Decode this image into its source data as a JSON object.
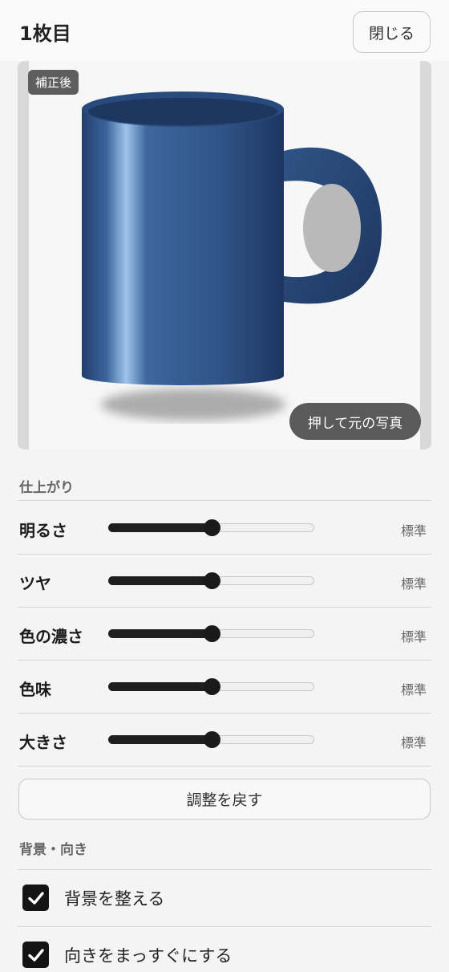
{
  "header": {
    "title": "1枚目",
    "close_label": "閉じる"
  },
  "preview": {
    "badge": "補正後",
    "show_original_label": "押して元の写真"
  },
  "finish": {
    "heading": "仕上がり",
    "sliders": [
      {
        "label": "明るさ",
        "value_text": "標準",
        "level": 0.5
      },
      {
        "label": "ツヤ",
        "value_text": "標準",
        "level": 0.5
      },
      {
        "label": "色の濃さ",
        "value_text": "標準",
        "level": 0.5
      },
      {
        "label": "色味",
        "value_text": "標準",
        "level": 0.5
      },
      {
        "label": "大きさ",
        "value_text": "標準",
        "level": 0.5
      }
    ],
    "reset_label": "調整を戻す"
  },
  "background": {
    "heading": "背景・向き",
    "options": [
      {
        "label": "背景を整える",
        "checked": true
      },
      {
        "label": "向きをまっすぐにする",
        "checked": true
      }
    ]
  },
  "colors": {
    "mug": "#2f5183",
    "slider_fill": "#1e1e1e"
  },
  "icons": [
    "checkmark-icon"
  ]
}
